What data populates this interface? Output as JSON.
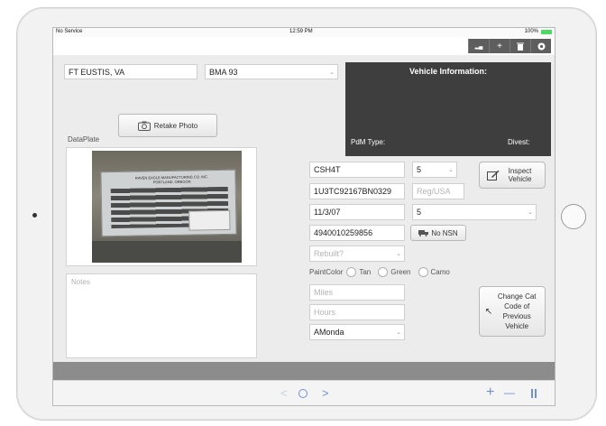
{
  "status_bar": {
    "carrier": "No Service",
    "time": "12:59 PM",
    "battery": "100%"
  },
  "toolbar": {
    "buttons": [
      {
        "icon": "signal-icon",
        "glyph": "▂▄"
      },
      {
        "icon": "add-icon",
        "glyph": "+"
      },
      {
        "icon": "trash-icon",
        "glyph": "🗑"
      },
      {
        "icon": "settings-icon",
        "glyph": "⚙"
      }
    ]
  },
  "location": {
    "value": "FT EUSTIS, VA"
  },
  "unit": {
    "value": "BMA 93"
  },
  "photo": {
    "retake_label": "Retake Photo",
    "dataplate_label": "DataPlate"
  },
  "plate_text": {
    "company": "RAVEN EAGLE MANUFACTURING CO. INC.",
    "city": "PORTLAND, OREGON"
  },
  "notes": {
    "placeholder": "Notes"
  },
  "vehicle_info": {
    "title": "Vehicle Information:",
    "pdm_label": "PdM Type:",
    "divest_label": "Divest:"
  },
  "form": {
    "model": "CSH4T",
    "count": "5",
    "vin": "1U3TC92167BN0329",
    "reg_placeholder": "Reg/USA",
    "date": "11/3/07",
    "date_select": "5",
    "nsn": "4940010259856",
    "no_nsn_label": "No NSN",
    "rebuilt_placeholder": "Rebuilt?",
    "paint_label": "PaintColor",
    "paint_options": [
      "Tan",
      "Green",
      "Camo"
    ],
    "miles_placeholder": "Miles",
    "hours_placeholder": "Hours",
    "user": "AMonda"
  },
  "inspect_button": {
    "label": "Inspect Vehicle"
  },
  "change_cat_button": {
    "label": "Change Cat Code of Previous Vehicle"
  },
  "bottom_bar": {
    "back": "<",
    "forward": ">",
    "plus": "+",
    "minus": "—"
  }
}
